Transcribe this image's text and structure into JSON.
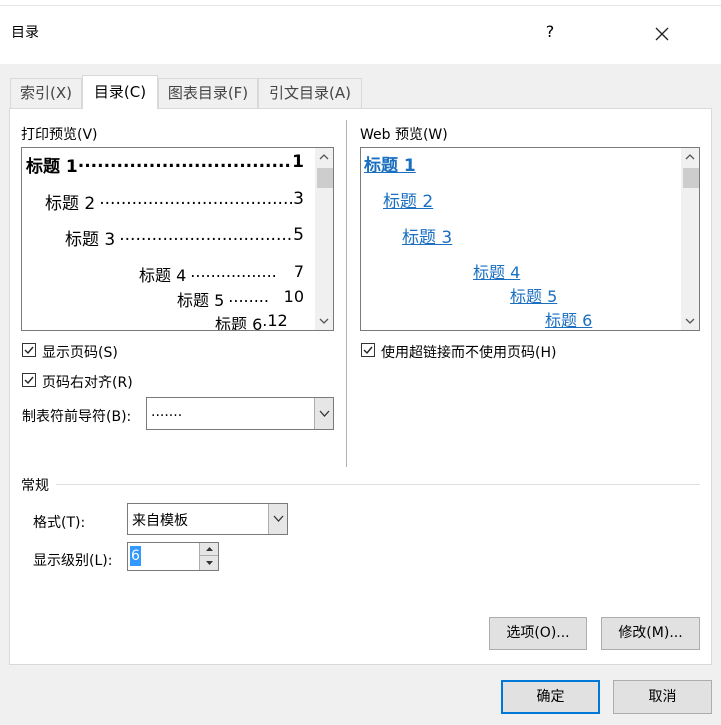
{
  "dialog": {
    "title": "目录",
    "help_label": "?"
  },
  "tabs": [
    {
      "label": "索引(X)"
    },
    {
      "label": "目录(C)"
    },
    {
      "label": "图表目录(F)"
    },
    {
      "label": "引文目录(A)"
    }
  ],
  "print_preview": {
    "label": "打印预览(V)",
    "lines": [
      {
        "text": "标题 1",
        "dots": "........................................",
        "page": "1"
      },
      {
        "text": "标题 2",
        "dots": "....................................",
        "page": "3"
      },
      {
        "text": "标题 3",
        "dots": "..................................",
        "page": "5"
      },
      {
        "text": "标题 4",
        "dots": ".................",
        "page": "7"
      },
      {
        "text": "标题 5",
        "dots": "........",
        "page": "10"
      },
      {
        "text": "标题 6",
        "dots": ".",
        "page": "12"
      }
    ]
  },
  "web_preview": {
    "label": "Web 预览(W)",
    "lines": [
      "标题 1",
      "标题 2",
      "标题 3",
      "标题 4",
      "标题 5",
      "标题 6"
    ]
  },
  "options": {
    "show_page_numbers": {
      "label": "显示页码(S)",
      "checked": true
    },
    "right_align": {
      "label": "页码右对齐(R)",
      "checked": true
    },
    "use_hyperlinks": {
      "label": "使用超链接而不使用页码(H)",
      "checked": true
    },
    "tab_leader": {
      "label": "制表符前导符(B):",
      "value": "......."
    }
  },
  "general": {
    "section_label": "常规",
    "format": {
      "label": "格式(T):",
      "value": "来自模板"
    },
    "levels": {
      "label": "显示级别(L):",
      "value": "6"
    }
  },
  "buttons": {
    "options": "选项(O)...",
    "modify": "修改(M)...",
    "ok": "确定",
    "cancel": "取消"
  }
}
